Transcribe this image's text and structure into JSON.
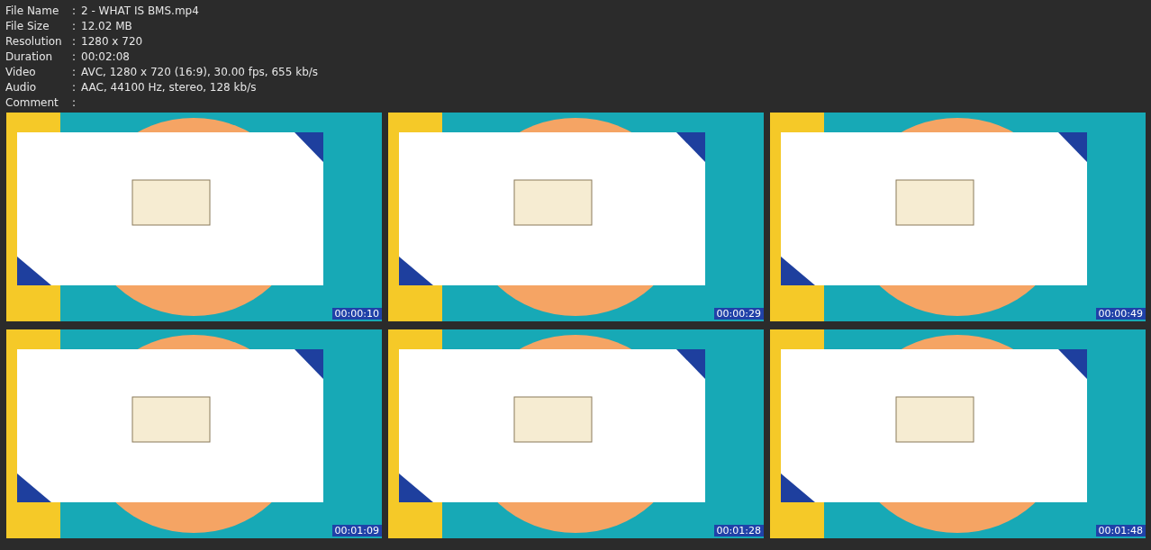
{
  "info": [
    {
      "label": "File Name",
      "value": "2 - WHAT IS BMS.mp4"
    },
    {
      "label": "File Size",
      "value": "12.02 MB"
    },
    {
      "label": "Resolution",
      "value": "1280 x 720"
    },
    {
      "label": "Duration",
      "value": "00:02:08"
    },
    {
      "label": "Video",
      "value": "AVC, 1280 x 720 (16:9), 30.00 fps, 655 kb/s"
    },
    {
      "label": "Audio",
      "value": "AAC, 44100 Hz, stereo, 128 kb/s"
    },
    {
      "label": "Comment"
    }
  ],
  "separator": ":",
  "frames": [
    {
      "timestamp": "00:00:10"
    },
    {
      "timestamp": "00:00:29"
    },
    {
      "timestamp": "00:00:49"
    },
    {
      "timestamp": "00:01:09"
    },
    {
      "timestamp": "00:01:28"
    },
    {
      "timestamp": "00:01:48"
    }
  ]
}
